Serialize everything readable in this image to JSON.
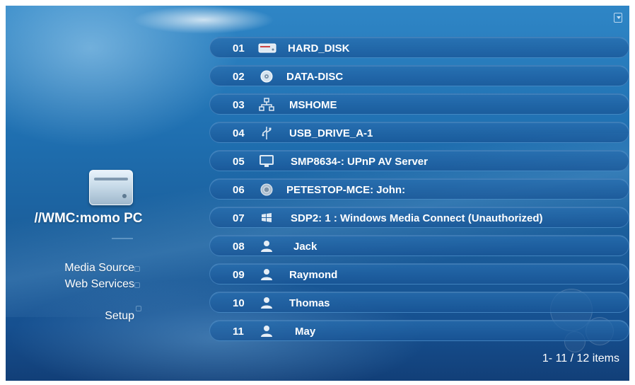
{
  "sidebar": {
    "device_title": "//WMC:momo PC",
    "menu": [
      {
        "label": "Media Source"
      },
      {
        "label": "Web Services"
      },
      {
        "label": "Setup"
      }
    ]
  },
  "list": {
    "rows": [
      {
        "num": "01",
        "label": "HARD_DISK",
        "icon": "hard-disk-icon"
      },
      {
        "num": "02",
        "label": "DATA-DISC",
        "icon": "disc-icon"
      },
      {
        "num": "03",
        "label": "MSHOME",
        "icon": "network-icon"
      },
      {
        "num": "04",
        "label": "USB_DRIVE_A-1",
        "icon": "usb-icon"
      },
      {
        "num": "05",
        "label": "SMP8634-: UPnP AV Server",
        "icon": "monitor-icon"
      },
      {
        "num": "06",
        "label": "PETESTOP-MCE: John:",
        "icon": "media-center-icon"
      },
      {
        "num": "07",
        "label": "SDP2: 1 : Windows Media Connect (Unauthorized)",
        "icon": "windows-icon"
      },
      {
        "num": "08",
        "label": "Jack",
        "icon": "user-icon"
      },
      {
        "num": "09",
        "label": "Raymond",
        "icon": "user-icon"
      },
      {
        "num": "10",
        "label": "Thomas",
        "icon": "user-icon"
      },
      {
        "num": "11",
        "label": "May",
        "icon": "user-icon"
      }
    ],
    "item_count": "1- 11 / 12 items"
  },
  "colors": {
    "background": "#1f6fb0",
    "row": "#1f5e9c",
    "text": "#ffffff"
  }
}
